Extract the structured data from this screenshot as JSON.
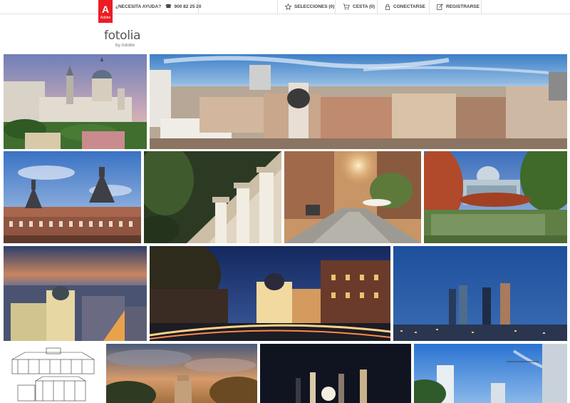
{
  "brand": {
    "adobe_badge": "Adobe",
    "logo_word": "fotolia",
    "logo_sub": "by Adobe",
    "brand_red": "#ed1c24"
  },
  "topbar": {
    "help_label": "¿NECESITA AYUDA?",
    "phone": "900 82 25 20",
    "selections_label": "SELECCIONES (0)",
    "cart_label": "CESTA (0)",
    "login_label": "CONECTARSE",
    "register_label": "REGISTRARSE",
    "icons": [
      "phone-icon",
      "star-icon",
      "cart-icon",
      "lock-icon",
      "edit-icon"
    ]
  },
  "gallery": {
    "rows": [
      [
        "royal-palace-cathedral",
        "madrid-rooftops-panorama"
      ],
      [
        "plaza-mayor",
        "stone-columns-facade",
        "cobblestone-street-sunset",
        "crystal-palace-retiro"
      ],
      [
        "metropolis-dusk-aerial",
        "gran-via-night",
        "cuatro-torres-blue-hour"
      ],
      [
        "palace-sketch",
        "alcala-gate-sunset",
        "towers-moon-night",
        "skyscrapers-blue-sky"
      ]
    ]
  }
}
